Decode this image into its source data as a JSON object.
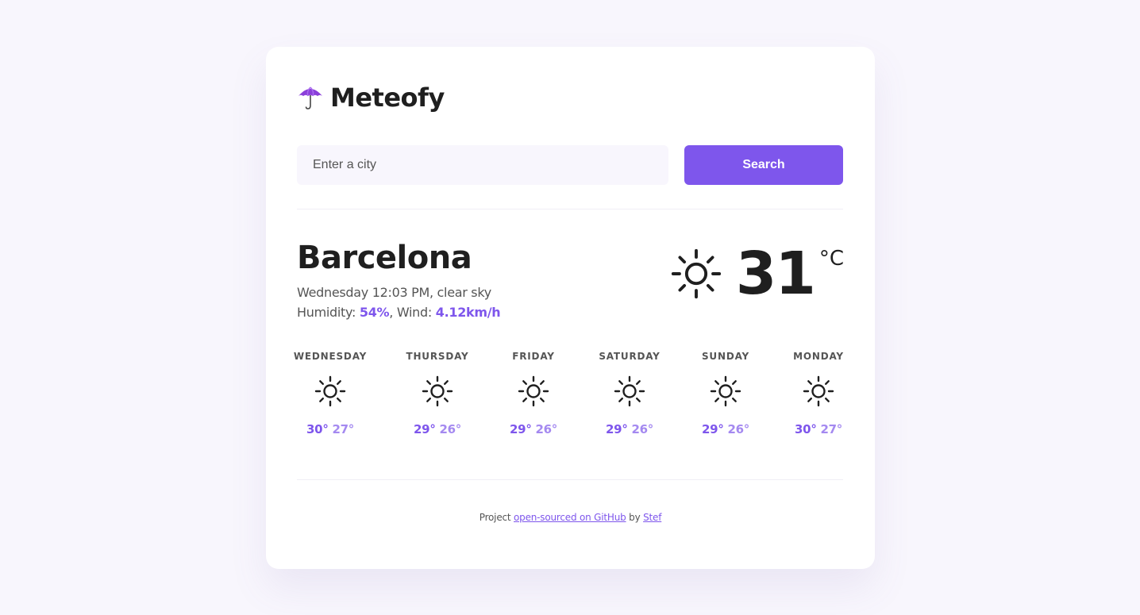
{
  "app": {
    "name": "Meteofy",
    "logo_icon": "umbrella-icon"
  },
  "search": {
    "placeholder": "Enter a city",
    "value": "",
    "button_label": "Search"
  },
  "current": {
    "city": "Barcelona",
    "datetime": "Wednesday 12:03 PM",
    "separator": ", ",
    "description": "clear sky",
    "humidity_label": "Humidity: ",
    "humidity_value": "54%",
    "wind_label": ", Wind: ",
    "wind_value": "4.12km/h",
    "icon": "sun-icon",
    "temperature": "31",
    "unit": "°C"
  },
  "forecast": [
    {
      "day": "WEDNESDAY",
      "icon": "sun-icon",
      "max": "30°",
      "min": "27°"
    },
    {
      "day": "THURSDAY",
      "icon": "sun-icon",
      "max": "29°",
      "min": "26°"
    },
    {
      "day": "FRIDAY",
      "icon": "sun-icon",
      "max": "29°",
      "min": "26°"
    },
    {
      "day": "SATURDAY",
      "icon": "sun-icon",
      "max": "29°",
      "min": "26°"
    },
    {
      "day": "SUNDAY",
      "icon": "sun-icon",
      "max": "29°",
      "min": "26°"
    },
    {
      "day": "MONDAY",
      "icon": "sun-icon",
      "max": "30°",
      "min": "27°"
    }
  ],
  "footer": {
    "prefix": "Project ",
    "link1": "open-sourced on GitHub",
    "middle": " by ",
    "link2": "Stef"
  },
  "colors": {
    "accent": "#7e56ec",
    "accent_light": "#a489f0",
    "background": "#f8f6fd",
    "text": "#1f1f1f"
  }
}
